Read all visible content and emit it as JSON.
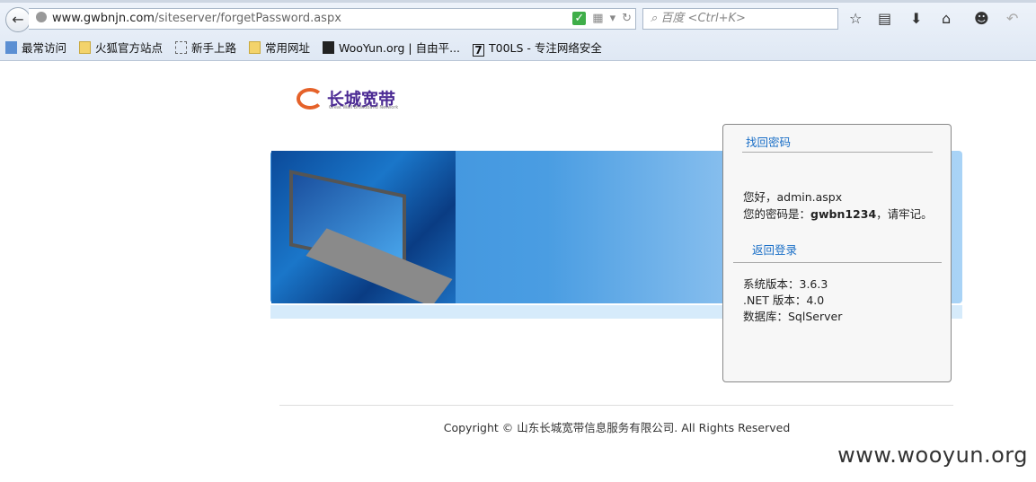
{
  "browser": {
    "url_host": "www.gwbnjn.com",
    "url_path": "/siteserver/forgetPassword.aspx",
    "search_placeholder": "百度 <Ctrl+K>",
    "bookmarks": [
      {
        "label": "最常访问",
        "icon": "search-icon"
      },
      {
        "label": "火狐官方站点",
        "icon": "folder-icon"
      },
      {
        "label": "新手上路",
        "icon": "dashed-page-icon"
      },
      {
        "label": "常用网址",
        "icon": "folder-icon"
      },
      {
        "label": "WooYun.org | 自由平...",
        "icon": "wooyun-icon"
      },
      {
        "label": "T00LS - 专注网络安全",
        "icon": "tools-icon"
      }
    ]
  },
  "logo": {
    "cn": "长城宽带",
    "en": "Great Wall Broadband Network"
  },
  "panel": {
    "title": "找回密码",
    "greeting": "您好，admin.aspx",
    "pw_prefix": "您的密码是：",
    "password": "gwbn1234",
    "pw_suffix": "，请牢记。",
    "back_login": "返回登录",
    "version": "系统版本：3.6.3",
    "dotnet": ".NET 版本：4.0",
    "database": "数据库：SqlServer"
  },
  "footer": {
    "copyright": "Copyright © 山东长城宽带信息服务有限公司. All Rights Reserved"
  },
  "watermark": "www.wooyun.org",
  "colors": {
    "link": "#1a6fc7",
    "banner": "#3a8fdc",
    "logo_purple": "#4c2b94",
    "logo_orange": "#e5622a"
  }
}
